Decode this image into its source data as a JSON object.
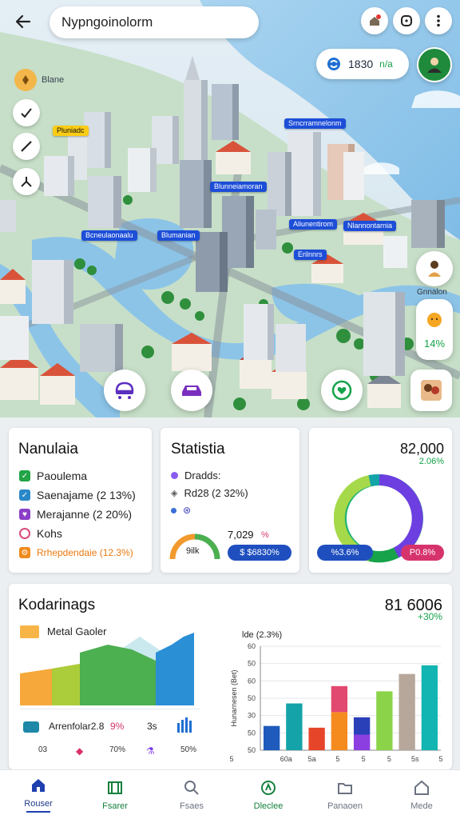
{
  "search": {
    "value": "Nypngoinolorm"
  },
  "balance": {
    "value": "1830",
    "change": "n/a"
  },
  "map": {
    "layer_label": "Blane",
    "tags": [
      {
        "text": "Pluniadc",
        "style": "yellow"
      },
      {
        "text": "Srncrramnelonm",
        "style": "blue"
      },
      {
        "text": "Blunneiamoran",
        "style": "blue"
      },
      {
        "text": "Bcneulaonaalu",
        "style": "blue"
      },
      {
        "text": "Blumanian",
        "style": "blue"
      },
      {
        "text": "Aliunentirom",
        "style": "blue"
      },
      {
        "text": "Nlannontarnia",
        "style": "blue"
      },
      {
        "text": "Erilnnrs",
        "style": "blue"
      }
    ],
    "side_label": "Gnnalon",
    "side_pct": "14%"
  },
  "card_left": {
    "title": "Nanulaia",
    "items": [
      {
        "label": "Paoulema",
        "color": "#22a447",
        "icon": "check-icon"
      },
      {
        "label": "Saenajame (2 13%)",
        "color": "#2a88c8",
        "icon": "check-icon"
      },
      {
        "label": "Merajanne (2 20%)",
        "color": "#8b3fc7",
        "icon": "heart-icon"
      },
      {
        "label": "Kohs",
        "color": "#d94a7a",
        "icon": "ring-icon"
      },
      {
        "label": "Rrhepdendaie (12.3%)",
        "color": "#f08a1c",
        "icon": "gear-icon",
        "text_color": "#e9790f"
      }
    ]
  },
  "card_mid": {
    "title": "Statistia",
    "items": [
      {
        "label": "Dradds:",
        "color": "#8a5cf0"
      },
      {
        "label": "Rd28 (2 32%)",
        "color": "#555"
      },
      {
        "label": "",
        "color": "#3b6fd8"
      }
    ],
    "gauge_label": "9ilk",
    "stat": "7,029",
    "stat_pct": "%",
    "badge": "$ $6830%"
  },
  "card_right": {
    "value": "82,000",
    "pct": "2.06%",
    "badge_left": "%3.6%",
    "badge_right": "P0.8%"
  },
  "card_bottom": {
    "title": "Kodarinags",
    "value": "81 6006",
    "pct": "+30%",
    "area": {
      "title": "Metal Gaoler",
      "legend_label": "Arrenfolar2.8",
      "legend_pct": "9%",
      "legend_num": "3s",
      "foot": [
        "03",
        "70%",
        "50%"
      ]
    },
    "bar": {
      "title": "lde (2.3%)"
    },
    "chart_data": {
      "type": "bar",
      "title": "lde (2.3%)",
      "ylabel": "Hunarnesen (Bet)",
      "ytick_labels": [
        "60",
        "50",
        "60",
        "50",
        "30",
        "50",
        "50"
      ],
      "xtick_labels": [
        "5",
        "60a",
        "5a",
        "5",
        "5",
        "5",
        "5s",
        "5"
      ],
      "ylim": [
        0,
        60
      ],
      "series": [
        {
          "values": [
            {
              "v": 14,
              "color": "#1e5bbd"
            },
            {
              "v": 27,
              "color": "#14a3a8"
            },
            {
              "v": 13,
              "color": "#e7452a"
            },
            {
              "v": 22,
              "color": "#f58a1f"
            },
            {
              "v": 9,
              "color": "#8b3fe0"
            },
            {
              "v": 34,
              "color": "#8bd44a"
            },
            {
              "v": 44,
              "color": "#b7a79a"
            },
            {
              "v": 49,
              "color": "#12b5b1"
            }
          ]
        },
        {
          "values": [
            {
              "v": 15,
              "color": "#e24970"
            },
            {
              "v": 10,
              "color": "#2a40b8"
            }
          ]
        }
      ]
    }
  },
  "nav": [
    {
      "label": "Rouser",
      "icon": "home-icon",
      "state": "active"
    },
    {
      "label": "Fsarer",
      "icon": "map-icon",
      "state": "green"
    },
    {
      "label": "Fsaes",
      "icon": "search-icon",
      "state": ""
    },
    {
      "label": "Dleclee",
      "icon": "explore-icon",
      "state": "green"
    },
    {
      "label": "Panaoen",
      "icon": "folder-icon",
      "state": ""
    },
    {
      "label": "Mede",
      "icon": "house-icon",
      "state": ""
    }
  ]
}
